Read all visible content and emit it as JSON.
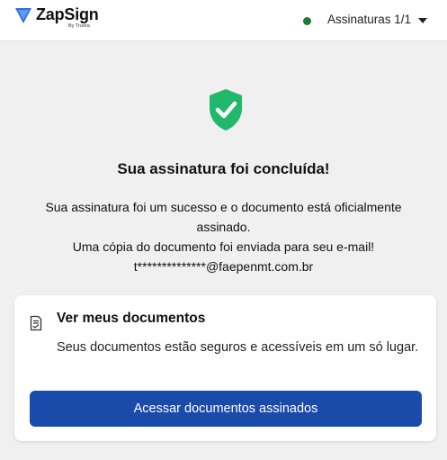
{
  "header": {
    "brand": "ZapSign",
    "brand_sub": "By Truora",
    "signatures_label": "Assinaturas 1/1",
    "status_color": "#1f7a3a",
    "icons": [
      "zapsign-logo",
      "status-dot",
      "caret-down-icon"
    ]
  },
  "main": {
    "icon": "shield-check-icon",
    "title": "Sua assinatura foi concluída!",
    "lines": [
      "Sua assinatura foi um sucesso e o documento está oficialmente",
      "assinado.",
      "Uma cópia do documento foi enviada para seu e-mail!",
      "t**************@faepenmt.com.br"
    ]
  },
  "card": {
    "icon": "document-icon",
    "title": "Ver meus documentos",
    "description": "Seus documentos estão seguros e acessíveis em um só lugar.",
    "button_label": "Acessar documentos assinados",
    "button_color": "#1a4bab"
  }
}
